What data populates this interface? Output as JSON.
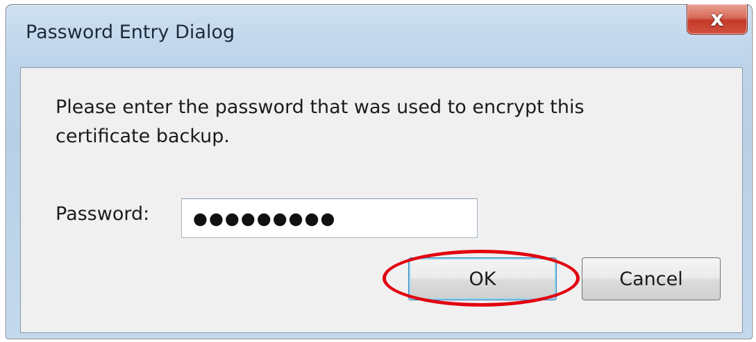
{
  "window": {
    "title": "Password Entry Dialog",
    "close_glyph": "x"
  },
  "dialog": {
    "message": "Please enter the password that was used to encrypt this certificate backup.",
    "password_label": "Password:",
    "password_value": "●●●●●●●●●"
  },
  "buttons": {
    "ok_label": "OK",
    "cancel_label": "Cancel"
  },
  "annotation": {
    "highlight_color": "#e2000f",
    "highlighted": "ok-button"
  },
  "icons": {
    "close": "close-icon"
  }
}
